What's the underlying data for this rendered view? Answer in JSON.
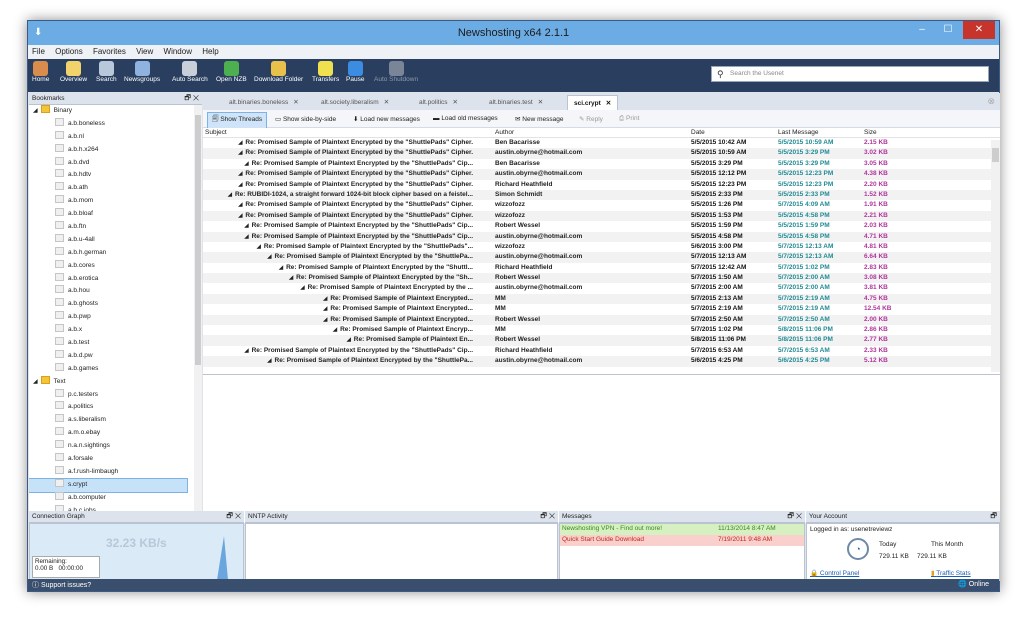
{
  "window": {
    "title": "Newshosting x64 2.1.1"
  },
  "menu": [
    "File",
    "Options",
    "Favorites",
    "View",
    "Window",
    "Help"
  ],
  "toolbar": [
    {
      "label": "Home",
      "icon": "home-icon",
      "color": "#d98c4b"
    },
    {
      "label": "Overview",
      "icon": "overview-icon",
      "color": "#f2d36b"
    },
    {
      "label": "Search",
      "icon": "search-icon",
      "color": "#b8c7da"
    },
    {
      "label": "Newsgroups",
      "icon": "newsgroups-icon",
      "color": "#8fb3de"
    },
    {
      "label": "Auto Search",
      "icon": "auto-search-icon",
      "color": "#c9cfd8"
    },
    {
      "label": "Open NZB",
      "icon": "open-nzb-icon",
      "color": "#4caf50"
    },
    {
      "label": "Download Folder",
      "icon": "folder-icon",
      "color": "#e8c14a"
    },
    {
      "label": "Transfers",
      "icon": "transfers-icon",
      "color": "#f0e050"
    },
    {
      "label": "Pause",
      "icon": "pause-icon",
      "color": "#3a8de0"
    },
    {
      "label": "Auto Shutdown",
      "icon": "shutdown-icon",
      "color": "#7a8698",
      "disabled": true
    }
  ],
  "search": {
    "placeholder": "Search the Usenet"
  },
  "bookmarks": {
    "title": "Bookmarks",
    "groups": [
      {
        "name": "Binary",
        "items": [
          "a.b.boneless",
          "a.b.nl",
          "a.b.h.x264",
          "a.b.dvd",
          "a.b.hdtv",
          "a.b.ath",
          "a.b.mom",
          "a.b.bloaf",
          "a.b.ftn",
          "a.b.u-4all",
          "a.b.h.german",
          "a.b.cores",
          "a.b.erotica",
          "a.b.hou",
          "a.b.ghosts",
          "a.b.pwp",
          "a.b.x",
          "a.b.test",
          "a.b.d.pw",
          "a.b.games"
        ]
      },
      {
        "name": "Text",
        "items": [
          "p.c.testers",
          "a.politics",
          "a.s.liberalism",
          "a.m.o.ebay",
          "n.a.n.sightings",
          "a.forsale",
          "a.f.rush-limbaugh",
          "s.crypt",
          "a.b.computer",
          "a.b.c.jobs"
        ]
      }
    ],
    "selected": "s.crypt"
  },
  "tabs": [
    {
      "label": "alt.binaries.boneless",
      "active": false
    },
    {
      "label": "alt.society.liberalism",
      "active": false
    },
    {
      "label": "alt.politics",
      "active": false
    },
    {
      "label": "alt.binaries.test",
      "active": false
    },
    {
      "label": "sci.crypt",
      "active": true
    }
  ],
  "actions": [
    {
      "label": "Show Threads",
      "active": true,
      "icon": "threads-icon"
    },
    {
      "label": "Show side-by-side",
      "icon": "side-by-side-icon"
    },
    {
      "label": "Load new messages",
      "icon": "load-new-icon"
    },
    {
      "label": "Load old messages",
      "icon": "load-old-icon"
    },
    {
      "label": "New message",
      "icon": "new-message-icon"
    },
    {
      "label": "Reply",
      "disabled": true,
      "icon": "reply-icon"
    },
    {
      "label": "Print",
      "disabled": true,
      "icon": "print-icon"
    }
  ],
  "columns": [
    "Subject",
    "Author",
    "Date",
    "Last Message",
    "Size"
  ],
  "messages": [
    {
      "indent": 0,
      "subject": "Re: Promised Sample of Plaintext Encrypted by the \"ShuttlePads\" Cipher.",
      "author": "Ben Bacarisse",
      "date": "5/5/2015 10:42 AM",
      "last": "5/5/2015 10:59 AM",
      "size": "2.15 KB"
    },
    {
      "indent": 1,
      "subject": "Re: Promised Sample of Plaintext Encrypted by the \"ShuttlePads\" Cipher.",
      "author": "austin.obyrne@hotmail.com",
      "date": "5/5/2015 10:59 AM",
      "last": "5/5/2015 3:29 PM",
      "size": "3.02 KB"
    },
    {
      "indent": 2,
      "subject": "Re: Promised Sample of Plaintext Encrypted by the \"ShuttlePads\" Cip...",
      "author": "Ben Bacarisse",
      "date": "5/5/2015 3:29 PM",
      "last": "5/5/2015 3:29 PM",
      "size": "3.05 KB"
    },
    {
      "indent": 0,
      "subject": "Re: Promised Sample of Plaintext Encrypted by the \"ShuttlePads\" Cipher.",
      "author": "austin.obyrne@hotmail.com",
      "date": "5/5/2015 12:12 PM",
      "last": "5/5/2015 12:23 PM",
      "size": "4.38 KB"
    },
    {
      "indent": 1,
      "subject": "Re: Promised Sample of Plaintext Encrypted by the \"ShuttlePads\" Cipher.",
      "author": "Richard Heathfield",
      "date": "5/5/2015 12:23 PM",
      "last": "5/5/2015 12:23 PM",
      "size": "2.20 KB"
    },
    {
      "indent": 0,
      "subject": "Re: RUBIDI-1024, a straight forward 1024-bit block cipher based on a feistel...",
      "author": "Simon Schmidt",
      "date": "5/5/2015 2:33 PM",
      "last": "5/5/2015 2:33 PM",
      "size": "1.52 KB"
    },
    {
      "indent": 0,
      "subject": "Re: Promised Sample of Plaintext Encrypted by the \"ShuttlePads\" Cipher.",
      "author": "wizzofozz",
      "date": "5/5/2015 1:26 PM",
      "last": "5/7/2015 4:09 AM",
      "size": "1.91 KB"
    },
    {
      "indent": 1,
      "subject": "Re: Promised Sample of Plaintext Encrypted by the \"ShuttlePads\" Cipher.",
      "author": "wizzofozz",
      "date": "5/5/2015 1:53 PM",
      "last": "5/5/2015 4:58 PM",
      "size": "2.21 KB"
    },
    {
      "indent": 2,
      "subject": "Re: Promised Sample of Plaintext Encrypted by the \"ShuttlePads\" Cip...",
      "author": "Robert Wessel",
      "date": "5/5/2015 1:59 PM",
      "last": "5/5/2015 1:59 PM",
      "size": "2.03 KB"
    },
    {
      "indent": 2,
      "subject": "Re: Promised Sample of Plaintext Encrypted by the \"ShuttlePads\" Cip...",
      "author": "austin.obyrne@hotmail.com",
      "date": "5/5/2015 4:58 PM",
      "last": "5/5/2015 4:58 PM",
      "size": "4.71 KB"
    },
    {
      "indent": 3,
      "subject": "Re: Promised Sample of Plaintext Encrypted by the \"ShuttlePads\"...",
      "author": "wizzofozz",
      "date": "5/6/2015 3:00 PM",
      "last": "5/7/2015 12:13 AM",
      "size": "4.81 KB"
    },
    {
      "indent": 4,
      "subject": "Re: Promised Sample of Plaintext Encrypted by the \"ShuttlePa...",
      "author": "austin.obyrne@hotmail.com",
      "date": "5/7/2015 12:13 AM",
      "last": "5/7/2015 12:13 AM",
      "size": "6.64 KB"
    },
    {
      "indent": 5,
      "subject": "Re: Promised Sample of Plaintext Encrypted by the \"Shuttl...",
      "author": "Richard Heathfield",
      "date": "5/7/2015 12:42 AM",
      "last": "5/7/2015 1:02 PM",
      "size": "2.83 KB"
    },
    {
      "indent": 6,
      "subject": "Re: Promised Sample of Plaintext Encrypted by the \"Sh...",
      "author": "Robert Wessel",
      "date": "5/7/2015 1:50 AM",
      "last": "5/7/2015 2:00 AM",
      "size": "3.08 KB"
    },
    {
      "indent": 7,
      "subject": "Re: Promised Sample of Plaintext Encrypted by the ...",
      "author": "austin.obyrne@hotmail.com",
      "date": "5/7/2015 2:00 AM",
      "last": "5/7/2015 2:00 AM",
      "size": "3.81 KB"
    },
    {
      "indent": 8,
      "subject": "Re: Promised Sample of Plaintext Encrypted...",
      "author": "MM",
      "date": "5/7/2015 2:13 AM",
      "last": "5/7/2015 2:19 AM",
      "size": "4.75 KB"
    },
    {
      "indent": 9,
      "subject": "Re: Promised Sample of Plaintext Encrypted...",
      "author": "MM",
      "date": "5/7/2015 2:19 AM",
      "last": "5/7/2015 2:19 AM",
      "size": "12.54 KB"
    },
    {
      "indent": 9,
      "subject": "Re: Promised Sample of Plaintext Encrypted...",
      "author": "Robert Wessel",
      "date": "5/7/2015 2:50 AM",
      "last": "5/7/2015 2:50 AM",
      "size": "2.00 KB"
    },
    {
      "indent": 10,
      "subject": "Re: Promised Sample of Plaintext Encryp...",
      "author": "MM",
      "date": "5/7/2015 1:02 PM",
      "last": "5/8/2015 11:06 PM",
      "size": "2.86 KB"
    },
    {
      "indent": 11,
      "subject": "Re: Promised Sample of Plaintext En...",
      "author": "Robert Wessel",
      "date": "5/8/2015 11:06 PM",
      "last": "5/8/2015 11:06 PM",
      "size": "2.77 KB"
    },
    {
      "indent": 3,
      "subject": "Re: Promised Sample of Plaintext Encrypted by the \"ShuttlePads\" Cip...",
      "author": "Richard Heathfield",
      "date": "5/7/2015 6:53 AM",
      "last": "5/7/2015 6:53 AM",
      "size": "2.33 KB"
    },
    {
      "indent": 2,
      "subject": "Re: Promised Sample of Plaintext Encrypted by the \"ShuttlePa...",
      "author": "austin.obyrne@hotmail.com",
      "date": "5/6/2015 4:25 PM",
      "last": "5/6/2015 4:25 PM",
      "size": "5.12 KB"
    }
  ],
  "panels": {
    "connection": {
      "title": "Connection Graph",
      "speed": "32.23 KB/s",
      "remaining_label": "Remaining:",
      "remaining_size": "0.00 B",
      "remaining_time": "00:00:00"
    },
    "nntp": {
      "title": "NNTP Activity"
    },
    "messages": {
      "title": "Messages",
      "items": [
        {
          "text": "Newshosting VPN - Find out more!",
          "date": "11/13/2014 8:47 AM",
          "bg": "#d6f0c2",
          "color": "#3a8a1e"
        },
        {
          "text": "Quick Start Guide Download",
          "date": "7/19/2011 9:48 AM",
          "bg": "#f9d0cc",
          "color": "#c0281c"
        }
      ]
    },
    "account": {
      "title": "Your Account",
      "logged_in": "Logged in as: usenetreviewz",
      "today_label": "Today",
      "month_label": "This Month",
      "today_value": "729.11 KB",
      "month_value": "729.11 KB",
      "control_panel": "Control Panel",
      "traffic_stats": "Traffic Stats"
    }
  },
  "status": {
    "support": "Support issues?",
    "online": "Online"
  }
}
